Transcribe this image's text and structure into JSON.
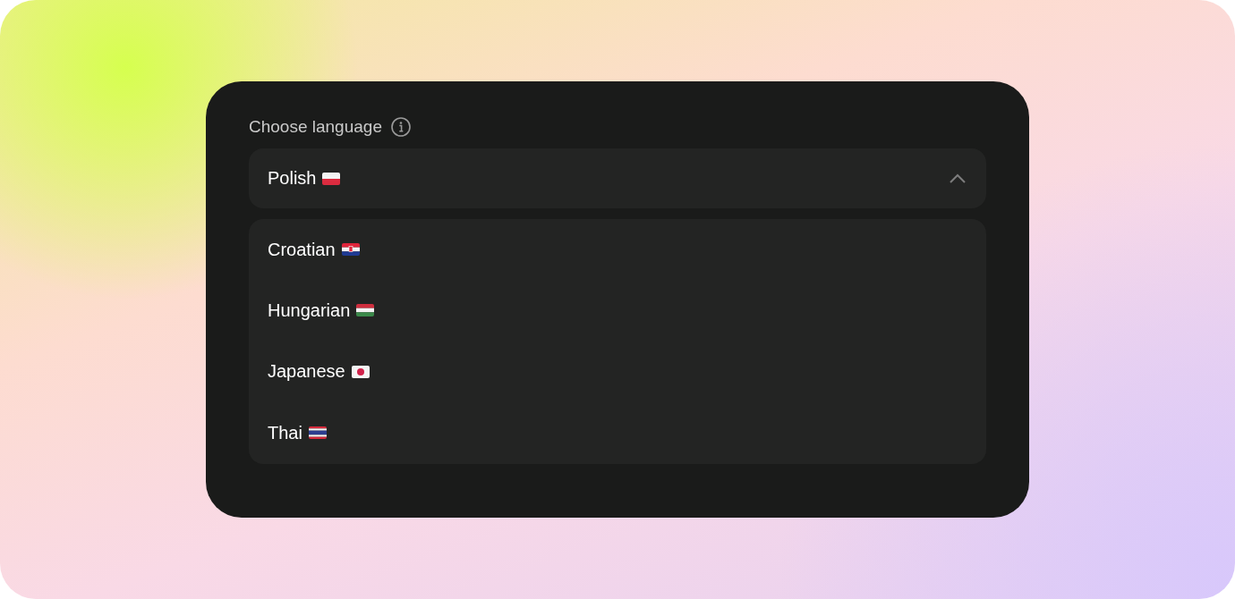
{
  "field": {
    "label": "Choose language",
    "value": {
      "label": "Polish",
      "kind": "pl"
    },
    "expanded": true
  },
  "options": [
    {
      "label": "Croatian",
      "kind": "hr"
    },
    {
      "label": "Hungarian",
      "kind": "hu"
    },
    {
      "label": "Japanese",
      "kind": "jp"
    },
    {
      "label": "Thai",
      "kind": "th"
    }
  ]
}
